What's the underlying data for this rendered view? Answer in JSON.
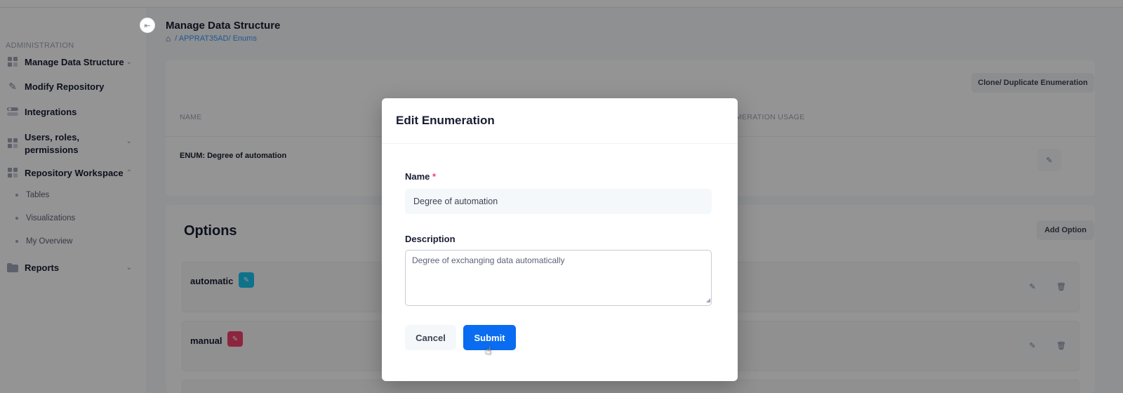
{
  "sidebar": {
    "section_label": "ADMINISTRATION",
    "collapse_icon": "arrow-left-icon",
    "items": [
      {
        "label": "Manage Data Structure",
        "icon": "grid-icon",
        "chevron": "chevron-down-icon"
      },
      {
        "label": "Modify Repository",
        "icon": "edit-icon"
      },
      {
        "label": "Integrations",
        "icon": "toggle-icon"
      },
      {
        "label": "Users, roles, permissions",
        "icon": "grid-icon",
        "chevron": "chevron-down-icon"
      },
      {
        "label": "Repository Workspace",
        "icon": "grid-icon",
        "chevron": "chevron-up-icon"
      },
      {
        "label": "Reports",
        "icon": "folder-icon",
        "chevron": "chevron-down-icon"
      }
    ],
    "sub_items": [
      "Tables",
      "Visualizations",
      "My Overview"
    ]
  },
  "header": {
    "title": "Manage Data Structure",
    "breadcrumb": "/ APPRAT35AD/ Enums"
  },
  "main": {
    "clone_button": "Clone/ Duplicate Enumeration",
    "columns": {
      "name": "NAME",
      "usage": "MERATION USAGE"
    },
    "row_name": "ENUM: Degree of automation",
    "options_title": "Options",
    "add_option_button": "Add Option",
    "options": [
      {
        "label": "automatic",
        "color": "#1bc5f0"
      },
      {
        "label": "manual",
        "color": "#f1416c"
      }
    ]
  },
  "modal": {
    "title": "Edit Enumeration",
    "name_label": "Name",
    "required_mark": "*",
    "name_value": "Degree of automation",
    "description_label": "Description",
    "description_value": "Degree of exchanging data automatically",
    "cancel_label": "Cancel",
    "submit_label": "Submit"
  },
  "colors": {
    "primary": "#0a6cf0",
    "link": "#3e97ff",
    "required": "#f1416c"
  }
}
